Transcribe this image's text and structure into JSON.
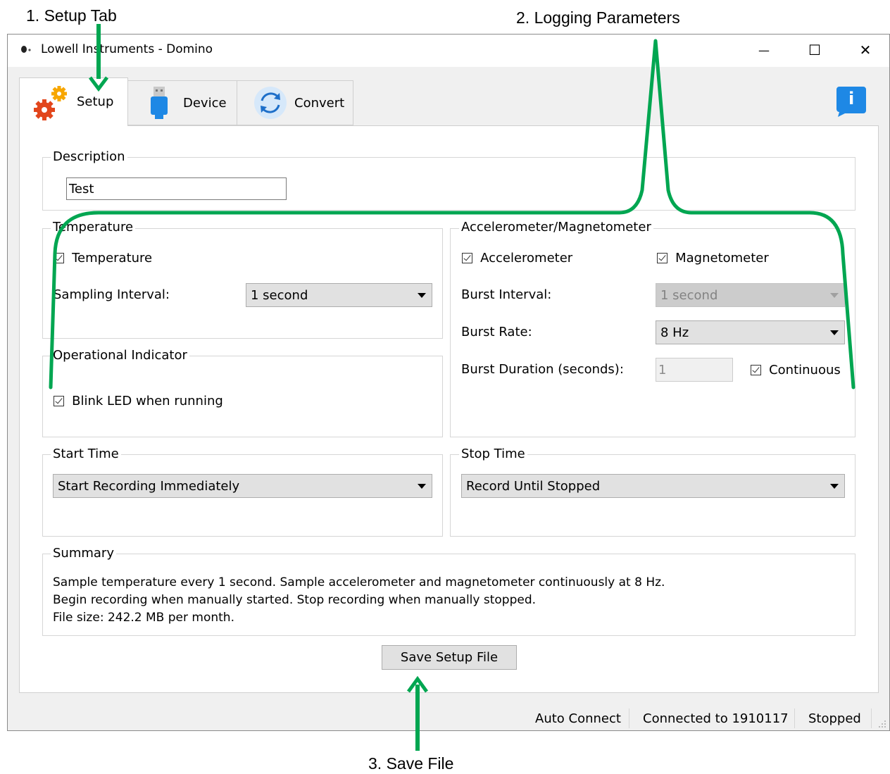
{
  "annotations": {
    "setup_tab": "1. Setup Tab",
    "logging_parameters": "2. Logging Parameters",
    "save_file": "3. Save File"
  },
  "window": {
    "title": "Lowell Instruments - Domino",
    "minimize": "—",
    "maximize": "☐",
    "close": "✕"
  },
  "tabs": [
    {
      "label": "Setup",
      "icon": "gears-icon",
      "active": true
    },
    {
      "label": "Device",
      "icon": "usb-icon",
      "active": false
    },
    {
      "label": "Convert",
      "icon": "refresh-icon",
      "active": false
    }
  ],
  "info_button": {
    "label": "i",
    "icon": "info-icon"
  },
  "description": {
    "title": "Description",
    "value": "Test"
  },
  "temperature": {
    "title": "Temperature",
    "checkbox_label": "Temperature",
    "checked": true,
    "sampling_label": "Sampling Interval:",
    "sampling_value": "1 second"
  },
  "operational_indicator": {
    "title": "Operational Indicator",
    "checkbox_label": "Blink LED when running",
    "checked": true
  },
  "accel_mag": {
    "title": "Accelerometer/Magnetometer",
    "accelerometer_label": "Accelerometer",
    "accelerometer_checked": true,
    "magnetometer_label": "Magnetometer",
    "magnetometer_checked": true,
    "burst_interval_label": "Burst Interval:",
    "burst_interval_value": "1 second",
    "burst_rate_label": "Burst Rate:",
    "burst_rate_value": "8 Hz",
    "burst_duration_label": "Burst Duration (seconds):",
    "burst_duration_value": "1",
    "continuous_label": "Continuous",
    "continuous_checked": true
  },
  "start_time": {
    "title": "Start Time",
    "value": "Start Recording Immediately"
  },
  "stop_time": {
    "title": "Stop Time",
    "value": "Record Until Stopped"
  },
  "summary": {
    "title": "Summary",
    "line1": "Sample temperature every 1 second. Sample accelerometer and magnetometer continuously at 8 Hz.",
    "line2": "Begin recording when manually started. Stop recording when manually stopped.",
    "line3": "File size: 242.2 MB per month."
  },
  "save_button": "Save Setup File",
  "status_bar": {
    "auto_connect": "Auto Connect",
    "connection": "Connected to 1910117",
    "state": "Stopped"
  },
  "colors": {
    "annotation_green": "#00a651",
    "info_blue": "#1e88e5",
    "gear_orange": "#f7a600",
    "gear_red": "#e2461c"
  }
}
